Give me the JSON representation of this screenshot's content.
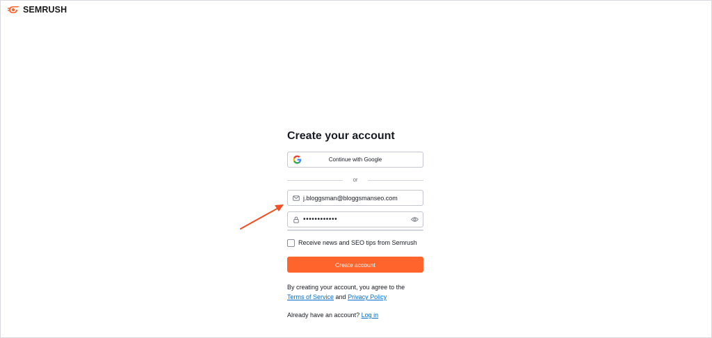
{
  "brand": {
    "name": "SEMRUSH",
    "logo_icon": "semrush-fireball-icon",
    "accent": "#ff642d"
  },
  "form": {
    "title": "Create your account",
    "google_button": {
      "label": "Continue with Google",
      "icon": "google-g-icon"
    },
    "divider_text": "or",
    "email": {
      "icon": "envelope-icon",
      "value": "j.bloggsman@bloggsmanseo.com"
    },
    "password": {
      "icon": "lock-icon",
      "value": "••••••••••••",
      "toggle_icon": "eye-icon"
    },
    "newsletter": {
      "label": "Receive news and SEO tips from Semrush",
      "checked": false
    },
    "submit": {
      "label": "Create account"
    },
    "terms": {
      "prefix": "By creating your account, you agree to the",
      "tos_link": "Terms of Service",
      "and": "and",
      "privacy_link": "Privacy Policy"
    },
    "login": {
      "prompt": "Already have an account?",
      "link": "Log in"
    }
  },
  "annotation": {
    "arrow_color": "#f04e23"
  },
  "colors": {
    "link": "#006dca",
    "button": "#ff642d"
  }
}
